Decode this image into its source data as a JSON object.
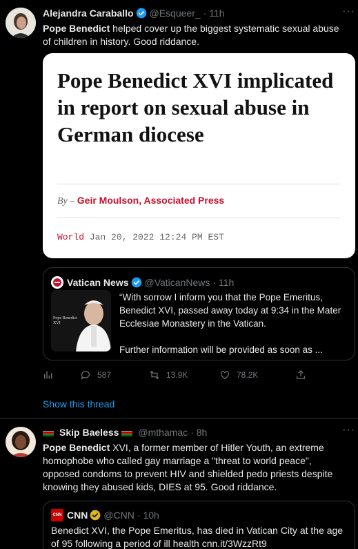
{
  "tweet1": {
    "name": "Alejandra Caraballo",
    "handle": "@Esqueer_",
    "time": "· 11h",
    "more": "···",
    "text_bold": "Pope Benedict",
    "text_rest": " helped cover up the biggest systematic sexual abuse of children in history. Good riddance.",
    "article": {
      "headline": "Pope Benedict XVI implicated in report on sexual abuse in German diocese",
      "byline_prefix": "By – ",
      "byline_author": "Geir Moulson, Associated Press",
      "section": "World",
      "date": "Jan 20, 2022 12:24 PM EST"
    },
    "quote": {
      "name": "Vatican News",
      "handle": "@VaticanNews",
      "time": "· 11h",
      "text": "“With sorrow I inform you that the Pope Emeritus, Benedict XVI, passed away today at 9:34 in the Mater Ecclesiae Monastery in the Vatican.\n\nFurther information will be provided as soon as ...",
      "image_caption": "Pope Benedict XVI"
    },
    "actions": {
      "replies": "587",
      "retweets": "13.9K",
      "likes": "78.2K"
    },
    "show_thread": "Show this thread"
  },
  "tweet2": {
    "name": "Skip Baeless",
    "handle": "@mthamac",
    "time": "· 8h",
    "more": "···",
    "text_bold": "Pope Benedict",
    "text_rest": " XVI, a former member of Hitler Youth, an extreme homophobe who called gay marriage a \"threat to world peace\", opposed condoms to prevent HIV and shielded pedo priests despite knowing they abused kids, DIES at 95. Good riddance.",
    "quote": {
      "name": "CNN",
      "handle": "@CNN",
      "time": "· 10h",
      "logo_text": "CNN",
      "text": "Benedict XVI, the Pope Emeritus, has died in Vatican City at the age of 95 following a period of ill health cnn.it/3WzzRt9"
    }
  },
  "colors": {
    "background": "#000000",
    "text": "#e7e9ea",
    "muted": "#71767b",
    "accent": "#1d9bf0",
    "border": "#2f3336",
    "verified_blue": "#1d9bf0",
    "verified_gold": "#e2b719",
    "ap_red": "#c8102e"
  }
}
